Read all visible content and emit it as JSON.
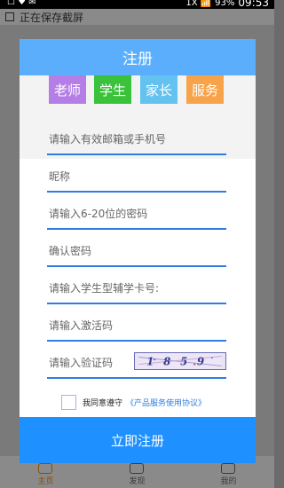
{
  "status_bar": {
    "left_text": "☐ ♥ ✉",
    "signal_text": "1X 📶",
    "battery_percent": "93%",
    "time": "09:53"
  },
  "background": {
    "top_text": "正在保存截屏",
    "tabs": [
      {
        "label": "主页"
      },
      {
        "label": "发现"
      },
      {
        "label": "我的"
      }
    ]
  },
  "dialog": {
    "title": "注册",
    "roles": [
      "老师",
      "学生",
      "家长",
      "服务"
    ],
    "fields": {
      "account_placeholder": "请输入有效邮箱或手机号",
      "nickname_placeholder": "昵称",
      "password_placeholder": "请输入6-20位的密码",
      "confirm_placeholder": "确认密码",
      "card_placeholder": "请输入学生型辅学卡号:",
      "activation_placeholder": "请输入激活码",
      "captcha_placeholder": "请输入验证码",
      "captcha_value": "1859"
    },
    "agreement": {
      "text": "我同意遵守",
      "link": "《产品服务使用协议》"
    },
    "submit_label": "立即注册"
  }
}
